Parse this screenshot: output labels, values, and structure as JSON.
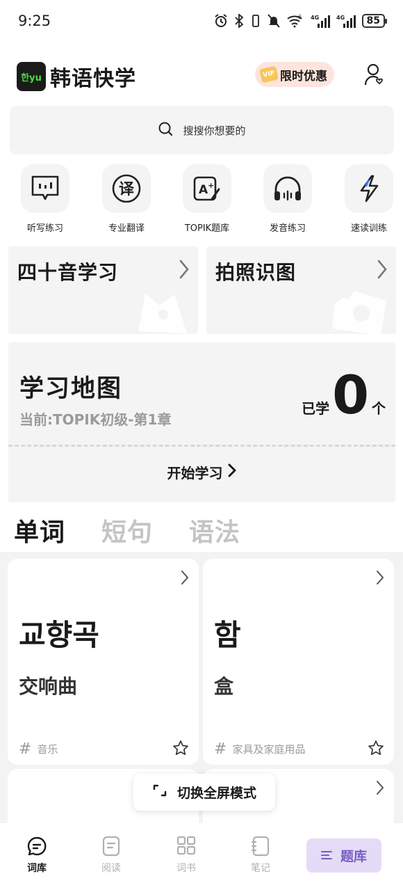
{
  "status_bar": {
    "time": "9:25",
    "battery": "85",
    "network1": "4G",
    "network2": "4G",
    "wifi_label": "6"
  },
  "header": {
    "logo_text": "한yu",
    "app_name": "韩语快学",
    "promo_label": "限时优惠",
    "vip_text": "VIP"
  },
  "search": {
    "placeholder": "搜搜你想要的"
  },
  "tools": [
    {
      "label": "听写练习",
      "icon": "dictation-icon"
    },
    {
      "label": "专业翻译",
      "icon": "translate-icon"
    },
    {
      "label": "TOPIK题库",
      "icon": "topik-icon"
    },
    {
      "label": "发音练习",
      "icon": "headphones-icon"
    },
    {
      "label": "速读训练",
      "icon": "lightning-icon"
    }
  ],
  "features": [
    {
      "title": "四十音学习"
    },
    {
      "title": "拍照识图"
    }
  ],
  "study_map": {
    "title": "学习地图",
    "current": "当前:TOPIK初级-第1章",
    "learned_label": "已学",
    "count": "0",
    "unit": "个",
    "start_label": "开始学习"
  },
  "tabs": [
    {
      "label": "单词",
      "active": true
    },
    {
      "label": "短句",
      "active": false
    },
    {
      "label": "语法",
      "active": false
    }
  ],
  "words": [
    {
      "korean": "교향곡",
      "chinese": "交响曲",
      "tag": "音乐"
    },
    {
      "korean": "함",
      "chinese": "盒",
      "tag": "家具及家庭用品"
    }
  ],
  "fullscreen_label": "切换全屏模式",
  "bottom_nav": {
    "items": [
      {
        "label": "词库",
        "active": true
      },
      {
        "label": "阅读",
        "active": false
      },
      {
        "label": "词书",
        "active": false
      },
      {
        "label": "笔记",
        "active": false
      }
    ],
    "quiz_label": "题库"
  },
  "colors": {
    "accent_purple": "#7a5cc5",
    "quiz_bg": "#e4dcf7",
    "promo_bg": "#fde4dc",
    "logo_green": "#4ade3a",
    "card_gray": "#f4f4f4"
  }
}
